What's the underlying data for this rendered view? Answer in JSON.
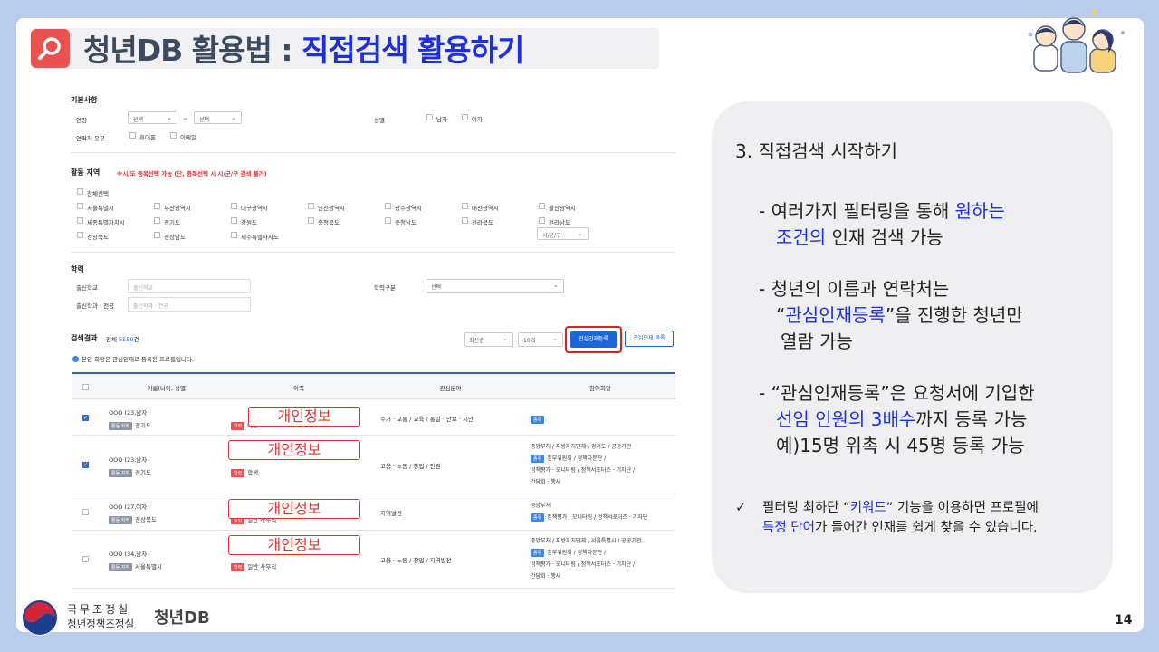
{
  "header": {
    "title_prefix": "청년DB 활용법 : ",
    "title_highlight": "직접검색 활용하기"
  },
  "search_form": {
    "basic_section": "기본사항",
    "age_label": "연령",
    "age_from": "선택",
    "age_sep": "~",
    "age_to": "선택",
    "gender_label": "성별",
    "gender_options": [
      "남자",
      "여자"
    ],
    "contact_label": "연락처 유무",
    "contact_options": [
      "휴대폰",
      "이메일"
    ],
    "region_section": "활동 지역",
    "region_warning": "※시/도 중복선택 가능 (단, 중복선택 시 시/군/구 검색 불가)",
    "region_all": "전체선택",
    "regions": [
      "서울특별시",
      "부산광역시",
      "대구광역시",
      "인천광역시",
      "광주광역시",
      "대전광역시",
      "울산광역시",
      "세종특별자치시",
      "경기도",
      "강원도",
      "충청북도",
      "충청남도",
      "전라북도",
      "전라남도",
      "경상북도",
      "경상남도",
      "제주특별자치도"
    ],
    "district_select": "시/군/구",
    "edu_section": "학력",
    "school_label": "출신학교",
    "school_placeholder": "출신학교",
    "edu_type_label": "학력구분",
    "edu_type_value": "선택",
    "major_label": "출신학과 · 전공",
    "major_placeholder": "출신학과 · 전공"
  },
  "results": {
    "label": "검색결과",
    "count_prefix": "전체 ",
    "count": "5559",
    "count_suffix": "건",
    "sort_value": "최신순",
    "page_size": "10개",
    "register_button": "관심인재등록",
    "list_button": "관심인재 목록",
    "notice": "본인 희망은 관심인재로 등록된 프로필입니다.",
    "columns": [
      "이름(나이, 성별)",
      "이력",
      "관심분야",
      "참여희망"
    ],
    "rows": [
      {
        "name": "OOO (23,남자)",
        "region_tag": "활동 지역",
        "region": "경기도",
        "career_tag": "학력",
        "career": "예술 ·",
        "interest": "주거 · 교통 / 교육 / 통일 · 안보 · 치안",
        "hope_tag": "종류",
        "hope": "",
        "hope_line2": "",
        "hope_line3": "",
        "checked": true
      },
      {
        "name": "OOO (23,남자)",
        "region_tag": "활동 지역",
        "region": "경기도",
        "career_tag": "학력",
        "career": "학생",
        "interest": "고용 · 노동 / 창업 / 인권",
        "hope_tag": "종류",
        "hope": "중앙부처 / 지방자치단체 / 경기도 / 공공기관",
        "hope_line2": "정부위원회 / 정책자문단 /",
        "hope_line3": "정책평가 · 모니터링 / 정책서포터즈 · 기자단 /",
        "hope_line4": "간담회 · 행사",
        "checked": true
      },
      {
        "name": "OOO (27,여자)",
        "region_tag": "활동 지역",
        "region": "경상북도",
        "career_tag": "학력",
        "career": "일반 사무직",
        "interest": "지역발전",
        "hope_tag": "종류",
        "hope": "중앙부처",
        "hope_line2": "정책평가 · 모니터링 / 정책서포터즈 · 기자단",
        "hope_line3": "",
        "checked": false
      },
      {
        "name": "OOO (34,남자)",
        "region_tag": "활동 지역",
        "region": "서울특별시",
        "career_tag": "학력",
        "career": "일반 사무직",
        "interest": "고용 · 노동 / 창업 / 지역발전",
        "hope_tag": "종류",
        "hope": "중앙부처 / 지방자치단체 / 서울특별시 / 공공기관",
        "hope_line2": "정부위원회 / 정책자문단 /",
        "hope_line3": "정책평가 · 모니터링 / 정책서포터즈 · 기자단 /",
        "hope_line4": "간담회 · 행사",
        "checked": false
      }
    ],
    "privacy_label": "개인정보"
  },
  "panel": {
    "step": "3.  직접검색 시작하기",
    "b1_l1_a": "- 여러가지 필터링을 통해 ",
    "b1_l1_b": "원하는",
    "b1_l2_a": "조건의",
    "b1_l2_b": " 인재 검색 가능",
    "b2_l1": "- 청년의 이름과 연락처는",
    "b2_l2_a": "“",
    "b2_l2_b": "관심인재등록",
    "b2_l2_c": "”을 진행한 청년만",
    "b2_l3": "열람 가능",
    "b3_l1": "- “관심인재등록”은 요청서에 기입한",
    "b3_l2_a": "선임 인원의 3배수",
    "b3_l2_b": "까지 등록 가능",
    "b3_l3": "예)15명 위촉 시 45명 등록 가능",
    "note_check": "✓",
    "note_l1_a": "필터링 최하단 “",
    "note_l1_b": "키워드",
    "note_l1_c": "” 기능을 이용하면 프로필에",
    "note_l2_a": "특정 단어",
    "note_l2_b": "가 들어간 인재를 쉽게 찾을 수 있습니다."
  },
  "footer": {
    "org": "국무조정실",
    "sub": "청년정책조정실",
    "db": "청년DB",
    "page": "14"
  },
  "colors": {
    "accent": "#1d2fe0",
    "title_icon": "#e8534f",
    "background": "#b9cceb",
    "panel": "#efeff1"
  }
}
